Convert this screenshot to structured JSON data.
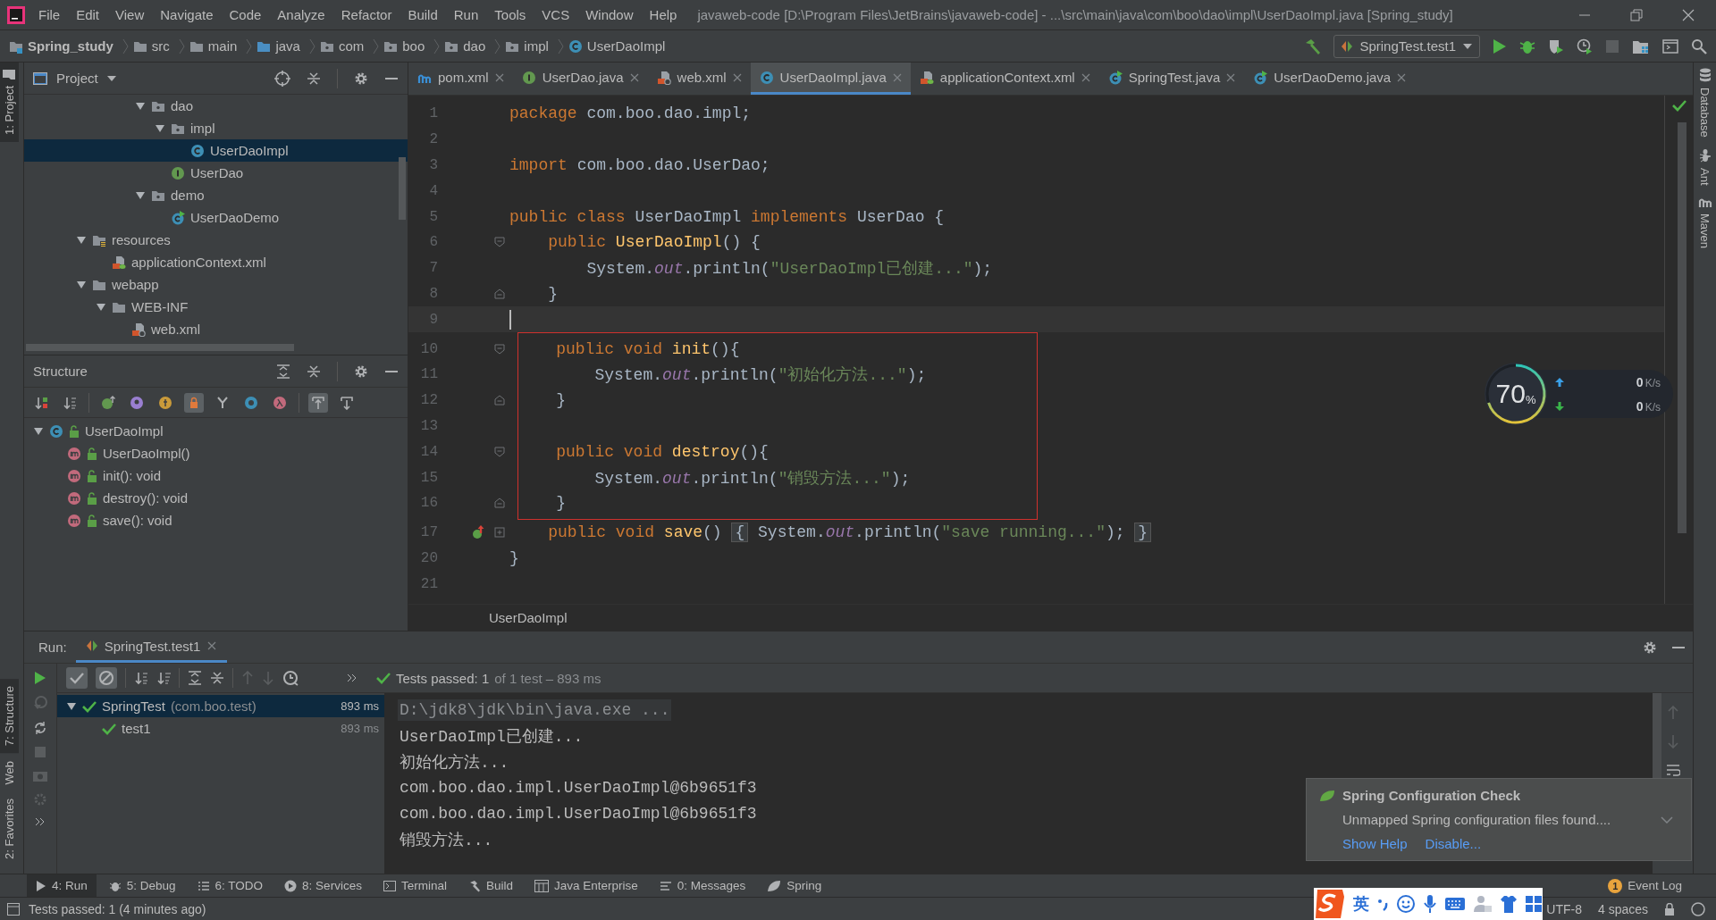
{
  "title_bar": {
    "menus": [
      "File",
      "Edit",
      "View",
      "Navigate",
      "Code",
      "Analyze",
      "Refactor",
      "Build",
      "Run",
      "Tools",
      "VCS",
      "Window",
      "Help"
    ],
    "title": "javaweb-code [D:\\Program Files\\JetBrains\\javaweb-code] - ...\\src\\main\\java\\com\\boo\\dao\\impl\\UserDaoImpl.java [Spring_study]"
  },
  "nav_bar": {
    "crumbs": [
      {
        "label": "Spring_study",
        "kind": "project"
      },
      {
        "label": "src",
        "kind": "folder"
      },
      {
        "label": "main",
        "kind": "folder"
      },
      {
        "label": "java",
        "kind": "source"
      },
      {
        "label": "com",
        "kind": "package"
      },
      {
        "label": "boo",
        "kind": "package"
      },
      {
        "label": "dao",
        "kind": "package"
      },
      {
        "label": "impl",
        "kind": "package"
      },
      {
        "label": "UserDaoImpl",
        "kind": "class"
      }
    ],
    "run_config": "SpringTest.test1"
  },
  "left_strip_top": [
    {
      "label": "1: Project",
      "selected": true
    }
  ],
  "left_strip_bottom": [
    {
      "label": "7: Structure",
      "selected": true
    },
    {
      "label": "Web",
      "selected": false
    },
    {
      "label": "2: Favorites",
      "selected": false
    }
  ],
  "project_panel": {
    "title": "Project",
    "tree": [
      {
        "label": "dao",
        "kind": "package",
        "expanded": true,
        "children": [
          {
            "label": "impl",
            "kind": "package",
            "expanded": true,
            "children": [
              {
                "label": "UserDaoImpl",
                "kind": "class",
                "selected": true
              }
            ]
          },
          {
            "label": "UserDao",
            "kind": "interface",
            "selected": false
          }
        ]
      },
      {
        "label": "demo",
        "kind": "package",
        "expanded": true,
        "children": [
          {
            "label": "UserDaoDemo",
            "kind": "runnable",
            "selected": false
          }
        ]
      },
      {
        "label": "resources",
        "kind": "resources",
        "expanded": true,
        "children": [
          {
            "label": "applicationContext.xml",
            "kind": "spring-xml",
            "selected": false
          }
        ]
      },
      {
        "label": "webapp",
        "kind": "folder",
        "expanded": true,
        "children": [
          {
            "label": "WEB-INF",
            "kind": "folder",
            "expanded": true,
            "children": [
              {
                "label": "web.xml",
                "kind": "web-xml",
                "selected": false
              }
            ]
          }
        ]
      }
    ]
  },
  "structure_panel": {
    "title": "Structure",
    "toolbar": [
      {
        "kind": "sort-visibility",
        "on": false
      },
      {
        "kind": "sort-alpha",
        "on": false
      },
      {
        "kind": "inherited",
        "on": false
      },
      {
        "kind": "properties",
        "on": false
      },
      {
        "kind": "fields",
        "on": false
      },
      {
        "kind": "non-public",
        "on": true
      },
      {
        "kind": "anonymous",
        "on": false
      },
      {
        "kind": "show-members",
        "on": false
      },
      {
        "kind": "lambdas",
        "on": false
      },
      {
        "kind": "autoscroll-to",
        "on": true
      },
      {
        "kind": "autoscroll-from",
        "on": false
      }
    ],
    "tree": [
      {
        "label": "UserDaoImpl",
        "kind": "class",
        "expanded": true,
        "children": [
          {
            "label": "UserDaoImpl()",
            "kind": "method"
          },
          {
            "label": "init(): void",
            "kind": "method"
          },
          {
            "label": "destroy(): void",
            "kind": "method"
          },
          {
            "label": "save(): void",
            "kind": "method"
          }
        ]
      }
    ]
  },
  "editor": {
    "tabs": [
      {
        "label": "pom.xml",
        "kind": "maven",
        "selected": false
      },
      {
        "label": "UserDao.java",
        "kind": "interface",
        "selected": false
      },
      {
        "label": "web.xml",
        "kind": "web-xml",
        "selected": false
      },
      {
        "label": "UserDaoImpl.java",
        "kind": "class",
        "selected": true
      },
      {
        "label": "applicationContext.xml",
        "kind": "spring-xml",
        "selected": false
      },
      {
        "label": "SpringTest.java",
        "kind": "runnable",
        "selected": false
      },
      {
        "label": "UserDaoDemo.java",
        "kind": "runnable",
        "selected": false
      }
    ],
    "blocks": [
      {
        "boxed": false,
        "lines": [
          {
            "n": "1",
            "current": false,
            "kind": "plain",
            "tokens": [
              {
                "kind": "kw",
                "t": "package "
              },
              {
                "kind": "pl",
                "t": "com.boo.dao.impl;"
              }
            ]
          },
          {
            "n": "2",
            "current": false,
            "kind": "plain"
          },
          {
            "n": "3",
            "current": false,
            "kind": "plain",
            "tokens": [
              {
                "kind": "kw",
                "t": "import "
              },
              {
                "kind": "pl",
                "t": "com.boo.dao.UserDao;"
              }
            ]
          },
          {
            "n": "4",
            "current": false,
            "kind": "plain"
          },
          {
            "n": "5",
            "current": false,
            "kind": "plain",
            "tokens": [
              {
                "kind": "kw",
                "t": "public class "
              },
              {
                "kind": "pl",
                "t": "UserDaoImpl "
              },
              {
                "kind": "kw",
                "t": "implements "
              },
              {
                "kind": "pl",
                "t": "UserDao {"
              }
            ]
          },
          {
            "n": "6",
            "current": false,
            "kind": "fold-start",
            "tokens": [
              {
                "kind": "kw",
                "t": "    public "
              },
              {
                "kind": "fn",
                "t": "UserDaoImpl"
              },
              {
                "kind": "pl",
                "t": "() {"
              }
            ]
          },
          {
            "n": "7",
            "current": false,
            "kind": "plain",
            "tokens": [
              {
                "kind": "pl",
                "t": "        System."
              },
              {
                "kind": "fld",
                "t": "out"
              },
              {
                "kind": "pl",
                "t": ".println("
              },
              {
                "kind": "str",
                "t": "\"UserDaoImpl已创建...\""
              },
              {
                "kind": "pl",
                "t": ");"
              }
            ]
          },
          {
            "n": "8",
            "current": false,
            "kind": "fold-end",
            "tokens": [
              {
                "kind": "pl",
                "t": "    }"
              }
            ]
          },
          {
            "n": "9",
            "current": true,
            "kind": "plain"
          }
        ]
      },
      {
        "boxed": true,
        "lines": [
          {
            "n": "10",
            "current": false,
            "kind": "fold-start",
            "tokens": [
              {
                "kind": "kw",
                "t": "    public void "
              },
              {
                "kind": "fn",
                "t": "init"
              },
              {
                "kind": "pl",
                "t": "(){"
              }
            ]
          },
          {
            "n": "11",
            "current": false,
            "kind": "plain",
            "tokens": [
              {
                "kind": "pl",
                "t": "        System."
              },
              {
                "kind": "fld",
                "t": "out"
              },
              {
                "kind": "pl",
                "t": ".println("
              },
              {
                "kind": "str",
                "t": "\"初始化方法...\""
              },
              {
                "kind": "pl",
                "t": ");"
              }
            ]
          },
          {
            "n": "12",
            "current": false,
            "kind": "fold-end",
            "tokens": [
              {
                "kind": "pl",
                "t": "    }"
              }
            ]
          },
          {
            "n": "13",
            "current": false,
            "kind": "plain"
          },
          {
            "n": "14",
            "current": false,
            "kind": "fold-start",
            "tokens": [
              {
                "kind": "kw",
                "t": "    public void "
              },
              {
                "kind": "fn",
                "t": "destroy"
              },
              {
                "kind": "pl",
                "t": "(){"
              }
            ]
          },
          {
            "n": "15",
            "current": false,
            "kind": "plain",
            "tokens": [
              {
                "kind": "pl",
                "t": "        System."
              },
              {
                "kind": "fld",
                "t": "out"
              },
              {
                "kind": "pl",
                "t": ".println("
              },
              {
                "kind": "str",
                "t": "\"销毁方法...\""
              },
              {
                "kind": "pl",
                "t": ");"
              }
            ]
          },
          {
            "n": "16",
            "current": false,
            "kind": "fold-end",
            "tokens": [
              {
                "kind": "pl",
                "t": "    }"
              }
            ]
          }
        ]
      },
      {
        "boxed": false,
        "lines": [
          {
            "n": "17",
            "current": false,
            "kind": "folded",
            "marker": true,
            "tokens": [
              {
                "kind": "kw",
                "t": "    public void "
              },
              {
                "kind": "fn",
                "t": "save"
              },
              {
                "kind": "pl",
                "t": "() "
              },
              {
                "kind": "fold",
                "t": "{"
              },
              {
                "kind": "pl",
                "t": " System."
              },
              {
                "kind": "fld",
                "t": "out"
              },
              {
                "kind": "pl",
                "t": ".println("
              },
              {
                "kind": "str",
                "t": "\"save running...\""
              },
              {
                "kind": "pl",
                "t": "); "
              },
              {
                "kind": "fold",
                "t": "}"
              }
            ]
          },
          {
            "n": "20",
            "current": false,
            "kind": "plain",
            "tokens": [
              {
                "kind": "pl",
                "t": "}"
              }
            ]
          },
          {
            "n": "21",
            "current": false,
            "kind": "plain"
          }
        ]
      }
    ],
    "breadcrumb": "UserDaoImpl"
  },
  "speed_widget": {
    "percent": "70",
    "percent_unit": "%",
    "upload": "0",
    "upload_unit": "K/s",
    "download": "0",
    "download_unit": "K/s"
  },
  "right_strip": [
    {
      "label": "Database",
      "kind": "database"
    },
    {
      "label": "Ant",
      "kind": "ant"
    },
    {
      "label": "Maven",
      "kind": "maven"
    }
  ],
  "run_panel": {
    "label": "Run:",
    "tab": "SpringTest.test1",
    "toolbar": [
      {
        "kind": "show-passed",
        "on": true
      },
      {
        "kind": "show-ignored",
        "on": true
      }
    ],
    "status": {
      "passed": "Tests passed: 1",
      "detail": "of 1 test – 893 ms"
    },
    "tree": [
      {
        "label": "SpringTest",
        "package": "(com.boo.test)",
        "time": "893 ms",
        "selected": true,
        "expanded": true,
        "children": [
          {
            "label": "test1",
            "time": "893 ms",
            "selected": false
          }
        ]
      }
    ],
    "console": [
      {
        "text": "D:\\jdk8\\jdk\\bin\\java.exe ...",
        "kind": "command"
      },
      {
        "text": "UserDaoImpl已创建...",
        "kind": "output"
      },
      {
        "text": "初始化方法...",
        "kind": "output"
      },
      {
        "text": "com.boo.dao.impl.UserDaoImpl@6b9651f3",
        "kind": "output"
      },
      {
        "text": "com.boo.dao.impl.UserDaoImpl@6b9651f3",
        "kind": "output"
      },
      {
        "text": "销毁方法...",
        "kind": "output"
      }
    ]
  },
  "tool_windows": [
    {
      "label": "4: Run",
      "kind": "run",
      "selected": true
    },
    {
      "label": "5: Debug",
      "kind": "debug",
      "selected": false
    },
    {
      "label": "6: TODO",
      "kind": "todo",
      "selected": false
    },
    {
      "label": "8: Services",
      "kind": "services",
      "selected": false
    },
    {
      "label": "Terminal",
      "kind": "terminal",
      "selected": false
    },
    {
      "label": "Build",
      "kind": "build",
      "selected": false
    },
    {
      "label": "Java Enterprise",
      "kind": "enterprise",
      "selected": false
    },
    {
      "label": "0: Messages",
      "kind": "messages",
      "selected": false
    },
    {
      "label": "Spring",
      "kind": "spring",
      "selected": false
    }
  ],
  "event_log": {
    "label": "Event Log",
    "count": "1"
  },
  "notification": {
    "title": "Spring Configuration Check",
    "body": "Unmapped Spring configuration files found....",
    "links": [
      "Show Help",
      "Disable..."
    ]
  },
  "status_bar": {
    "message": "Tests passed: 1 (4 minutes ago)",
    "encoding": "UTF-8",
    "indent": "4 spaces"
  },
  "ime_bar": {
    "language": "英"
  }
}
